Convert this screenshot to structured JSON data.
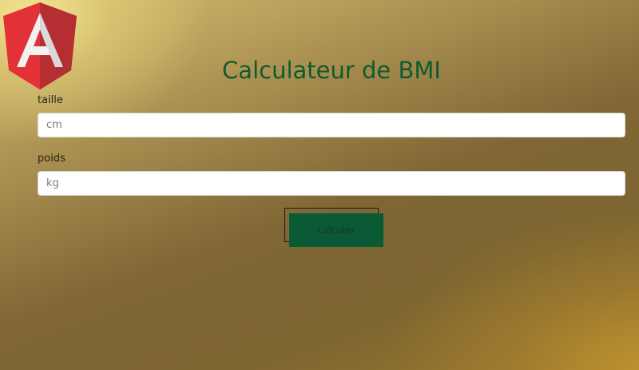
{
  "logo": {
    "icon": "angular-logo-icon",
    "letter": "A",
    "colors": [
      "#dd0031",
      "#c3002f",
      "#ffffff"
    ]
  },
  "page": {
    "title": "Calculateur de BMI"
  },
  "form": {
    "taille": {
      "label": "taille",
      "placeholder": "cm",
      "value": ""
    },
    "poids": {
      "label": "poids",
      "placeholder": "kg",
      "value": ""
    },
    "submit_label": "calculer"
  },
  "colors": {
    "title": "#0e5b2f",
    "button": "#0a5a36"
  }
}
